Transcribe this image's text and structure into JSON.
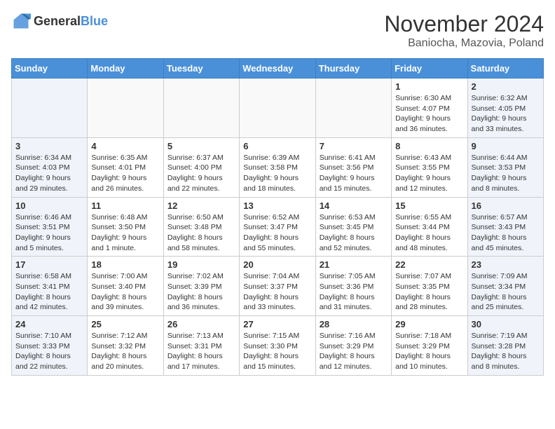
{
  "logo": {
    "general": "General",
    "blue": "Blue"
  },
  "header": {
    "month": "November 2024",
    "location": "Baniocha, Mazovia, Poland"
  },
  "weekdays": [
    "Sunday",
    "Monday",
    "Tuesday",
    "Wednesday",
    "Thursday",
    "Friday",
    "Saturday"
  ],
  "weeks": [
    [
      {
        "day": "",
        "info": "",
        "weekend": false
      },
      {
        "day": "",
        "info": "",
        "weekend": false
      },
      {
        "day": "",
        "info": "",
        "weekend": false
      },
      {
        "day": "",
        "info": "",
        "weekend": false
      },
      {
        "day": "",
        "info": "",
        "weekend": false
      },
      {
        "day": "1",
        "info": "Sunrise: 6:30 AM\nSunset: 4:07 PM\nDaylight: 9 hours and 36 minutes.",
        "weekend": false
      },
      {
        "day": "2",
        "info": "Sunrise: 6:32 AM\nSunset: 4:05 PM\nDaylight: 9 hours and 33 minutes.",
        "weekend": true
      }
    ],
    [
      {
        "day": "3",
        "info": "Sunrise: 6:34 AM\nSunset: 4:03 PM\nDaylight: 9 hours and 29 minutes.",
        "weekend": true
      },
      {
        "day": "4",
        "info": "Sunrise: 6:35 AM\nSunset: 4:01 PM\nDaylight: 9 hours and 26 minutes.",
        "weekend": false
      },
      {
        "day": "5",
        "info": "Sunrise: 6:37 AM\nSunset: 4:00 PM\nDaylight: 9 hours and 22 minutes.",
        "weekend": false
      },
      {
        "day": "6",
        "info": "Sunrise: 6:39 AM\nSunset: 3:58 PM\nDaylight: 9 hours and 18 minutes.",
        "weekend": false
      },
      {
        "day": "7",
        "info": "Sunrise: 6:41 AM\nSunset: 3:56 PM\nDaylight: 9 hours and 15 minutes.",
        "weekend": false
      },
      {
        "day": "8",
        "info": "Sunrise: 6:43 AM\nSunset: 3:55 PM\nDaylight: 9 hours and 12 minutes.",
        "weekend": false
      },
      {
        "day": "9",
        "info": "Sunrise: 6:44 AM\nSunset: 3:53 PM\nDaylight: 9 hours and 8 minutes.",
        "weekend": true
      }
    ],
    [
      {
        "day": "10",
        "info": "Sunrise: 6:46 AM\nSunset: 3:51 PM\nDaylight: 9 hours and 5 minutes.",
        "weekend": true
      },
      {
        "day": "11",
        "info": "Sunrise: 6:48 AM\nSunset: 3:50 PM\nDaylight: 9 hours and 1 minute.",
        "weekend": false
      },
      {
        "day": "12",
        "info": "Sunrise: 6:50 AM\nSunset: 3:48 PM\nDaylight: 8 hours and 58 minutes.",
        "weekend": false
      },
      {
        "day": "13",
        "info": "Sunrise: 6:52 AM\nSunset: 3:47 PM\nDaylight: 8 hours and 55 minutes.",
        "weekend": false
      },
      {
        "day": "14",
        "info": "Sunrise: 6:53 AM\nSunset: 3:45 PM\nDaylight: 8 hours and 52 minutes.",
        "weekend": false
      },
      {
        "day": "15",
        "info": "Sunrise: 6:55 AM\nSunset: 3:44 PM\nDaylight: 8 hours and 48 minutes.",
        "weekend": false
      },
      {
        "day": "16",
        "info": "Sunrise: 6:57 AM\nSunset: 3:43 PM\nDaylight: 8 hours and 45 minutes.",
        "weekend": true
      }
    ],
    [
      {
        "day": "17",
        "info": "Sunrise: 6:58 AM\nSunset: 3:41 PM\nDaylight: 8 hours and 42 minutes.",
        "weekend": true
      },
      {
        "day": "18",
        "info": "Sunrise: 7:00 AM\nSunset: 3:40 PM\nDaylight: 8 hours and 39 minutes.",
        "weekend": false
      },
      {
        "day": "19",
        "info": "Sunrise: 7:02 AM\nSunset: 3:39 PM\nDaylight: 8 hours and 36 minutes.",
        "weekend": false
      },
      {
        "day": "20",
        "info": "Sunrise: 7:04 AM\nSunset: 3:37 PM\nDaylight: 8 hours and 33 minutes.",
        "weekend": false
      },
      {
        "day": "21",
        "info": "Sunrise: 7:05 AM\nSunset: 3:36 PM\nDaylight: 8 hours and 31 minutes.",
        "weekend": false
      },
      {
        "day": "22",
        "info": "Sunrise: 7:07 AM\nSunset: 3:35 PM\nDaylight: 8 hours and 28 minutes.",
        "weekend": false
      },
      {
        "day": "23",
        "info": "Sunrise: 7:09 AM\nSunset: 3:34 PM\nDaylight: 8 hours and 25 minutes.",
        "weekend": true
      }
    ],
    [
      {
        "day": "24",
        "info": "Sunrise: 7:10 AM\nSunset: 3:33 PM\nDaylight: 8 hours and 22 minutes.",
        "weekend": true
      },
      {
        "day": "25",
        "info": "Sunrise: 7:12 AM\nSunset: 3:32 PM\nDaylight: 8 hours and 20 minutes.",
        "weekend": false
      },
      {
        "day": "26",
        "info": "Sunrise: 7:13 AM\nSunset: 3:31 PM\nDaylight: 8 hours and 17 minutes.",
        "weekend": false
      },
      {
        "day": "27",
        "info": "Sunrise: 7:15 AM\nSunset: 3:30 PM\nDaylight: 8 hours and 15 minutes.",
        "weekend": false
      },
      {
        "day": "28",
        "info": "Sunrise: 7:16 AM\nSunset: 3:29 PM\nDaylight: 8 hours and 12 minutes.",
        "weekend": false
      },
      {
        "day": "29",
        "info": "Sunrise: 7:18 AM\nSunset: 3:29 PM\nDaylight: 8 hours and 10 minutes.",
        "weekend": false
      },
      {
        "day": "30",
        "info": "Sunrise: 7:19 AM\nSunset: 3:28 PM\nDaylight: 8 hours and 8 minutes.",
        "weekend": true
      }
    ]
  ]
}
